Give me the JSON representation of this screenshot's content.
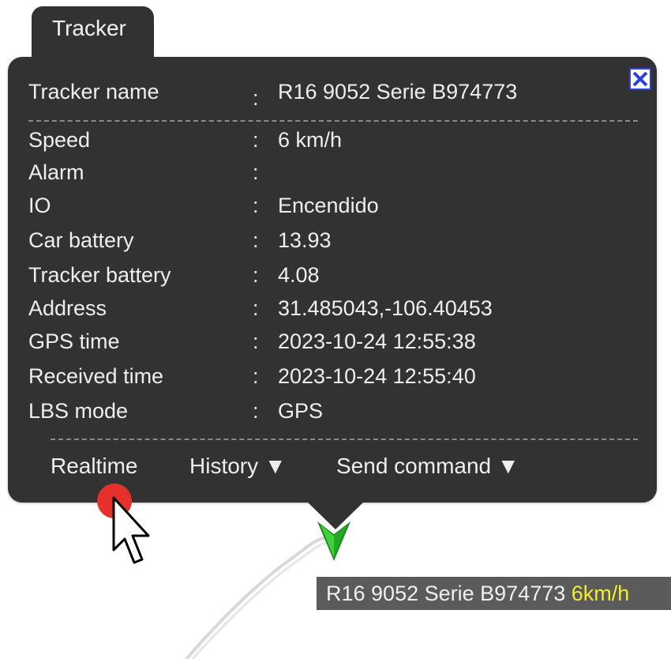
{
  "popup": {
    "tab_title": "Tracker",
    "rows": [
      {
        "label": "Tracker name",
        "sep": ":",
        "value": "R16 9052 Serie B974773"
      },
      {
        "label": "Speed",
        "sep": ":",
        "value": "6 km/h"
      },
      {
        "label": "Alarm",
        "sep": ":",
        "value": ""
      },
      {
        "label": "IO",
        "sep": ":",
        "value": "Encendido"
      },
      {
        "label": "Car battery",
        "sep": ":",
        "value": "13.93"
      },
      {
        "label": "Tracker battery",
        "sep": ":",
        "value": "4.08"
      },
      {
        "label": "Address",
        "sep": ":",
        "value": "31.485043,-106.40453"
      },
      {
        "label": "GPS time",
        "sep": ":",
        "value": "2023-10-24 12:55:38"
      },
      {
        "label": "Received time",
        "sep": ":",
        "value": "2023-10-24 12:55:40"
      },
      {
        "label": "LBS mode",
        "sep": ":",
        "value": "GPS"
      }
    ],
    "actions": {
      "realtime": "Realtime",
      "history": "History ▼",
      "send_command": "Send command ▼"
    },
    "close_icon": "close-x-icon"
  },
  "map_label": {
    "name": "R16 9052 Serie B974773",
    "speed": "6km/h"
  },
  "colors": {
    "popup_bg": "#323232",
    "text": "#eeeeee",
    "speed_highlight": "#f2ee2b",
    "marker": "#2ecc2e",
    "close_border": "#2d3fe0",
    "click_indicator": "#e5312c"
  }
}
